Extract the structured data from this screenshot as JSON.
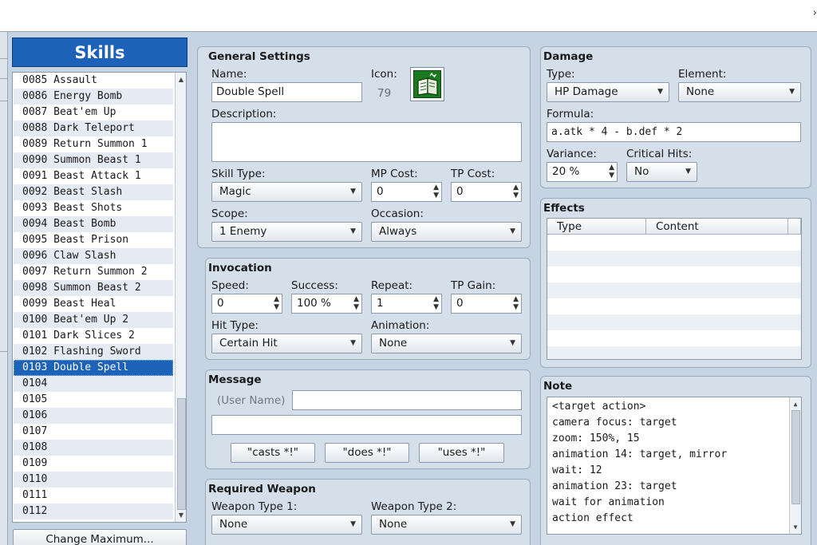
{
  "window": {
    "close_glyph": "›"
  },
  "skills_list": {
    "header": "Skills",
    "items": [
      {
        "label": "0085 Assault"
      },
      {
        "label": "0086 Energy Bomb"
      },
      {
        "label": "0087 Beat'em Up"
      },
      {
        "label": "0088 Dark Teleport"
      },
      {
        "label": "0089 Return Summon 1"
      },
      {
        "label": "0090 Summon Beast 1"
      },
      {
        "label": "0091 Beast Attack 1"
      },
      {
        "label": "0092 Beast Slash"
      },
      {
        "label": "0093 Beast Shots"
      },
      {
        "label": "0094 Beast Bomb"
      },
      {
        "label": "0095 Beast Prison"
      },
      {
        "label": "0096 Claw Slash"
      },
      {
        "label": "0097 Return Summon 2"
      },
      {
        "label": "0098 Summon Beast 2"
      },
      {
        "label": "0099 Beast Heal"
      },
      {
        "label": "0100 Beat'em Up 2"
      },
      {
        "label": "0101 Dark Slices 2"
      },
      {
        "label": "0102 Flashing Sword"
      },
      {
        "label": "0103 Double Spell"
      },
      {
        "label": "0104"
      },
      {
        "label": "0105"
      },
      {
        "label": "0106"
      },
      {
        "label": "0107"
      },
      {
        "label": "0108"
      },
      {
        "label": "0109"
      },
      {
        "label": "0110"
      },
      {
        "label": "0111"
      },
      {
        "label": "0112"
      }
    ],
    "selected_index": 18,
    "change_max_label": "Change Maximum..."
  },
  "general": {
    "title": "General Settings",
    "name_label": "Name:",
    "name_value": "Double Spell",
    "icon_label": "Icon:",
    "icon_index": "79",
    "icon_name": "spellbook-icon",
    "description_label": "Description:",
    "description_value": "",
    "skill_type_label": "Skill Type:",
    "skill_type_value": "Magic",
    "mp_cost_label": "MP Cost:",
    "mp_cost_value": "0",
    "tp_cost_label": "TP Cost:",
    "tp_cost_value": "0",
    "scope_label": "Scope:",
    "scope_value": "1 Enemy",
    "occasion_label": "Occasion:",
    "occasion_value": "Always"
  },
  "invocation": {
    "title": "Invocation",
    "speed_label": "Speed:",
    "speed_value": "0",
    "success_label": "Success:",
    "success_value": "100 %",
    "repeat_label": "Repeat:",
    "repeat_value": "1",
    "tp_gain_label": "TP Gain:",
    "tp_gain_value": "0",
    "hit_type_label": "Hit Type:",
    "hit_type_value": "Certain Hit",
    "animation_label": "Animation:",
    "animation_value": "None"
  },
  "message": {
    "title": "Message",
    "user_name_placeholder": "(User Name)",
    "line1_value": "",
    "line2_value": "",
    "buttons": [
      "\"casts *!\"",
      "\"does *!\"",
      "\"uses *!\""
    ]
  },
  "required_weapon": {
    "title": "Required Weapon",
    "type1_label": "Weapon Type 1:",
    "type1_value": "None",
    "type2_label": "Weapon Type 2:",
    "type2_value": "None"
  },
  "damage": {
    "title": "Damage",
    "type_label": "Type:",
    "type_value": "HP Damage",
    "element_label": "Element:",
    "element_value": "None",
    "formula_label": "Formula:",
    "formula_value": "a.atk * 4 - b.def * 2",
    "variance_label": "Variance:",
    "variance_value": "20 %",
    "critical_label": "Critical Hits:",
    "critical_value": "No"
  },
  "effects": {
    "title": "Effects",
    "columns": [
      "Type",
      "Content"
    ]
  },
  "note": {
    "title": "Note",
    "lines": [
      "<target action>",
      "camera focus: target",
      "zoom: 150%, 15",
      "animation 14: target, mirror",
      "wait: 12",
      "animation 23: target",
      "wait for animation",
      "action effect"
    ]
  }
}
